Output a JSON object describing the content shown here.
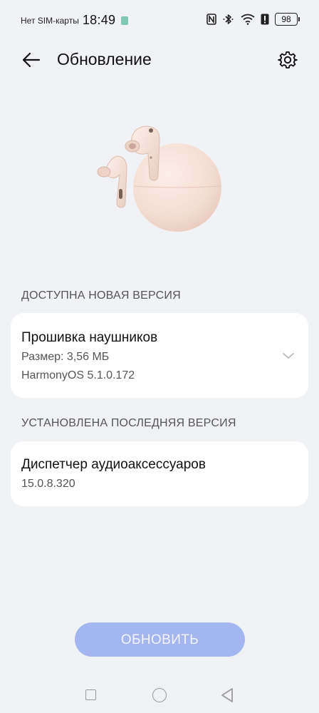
{
  "status_bar": {
    "carrier": "Нет SIM-карты",
    "time": "18:49",
    "battery": "98",
    "icons": [
      "sim-icon",
      "nfc-icon",
      "bluetooth-icon",
      "wifi-icon",
      "alert-icon",
      "battery-icon"
    ]
  },
  "header": {
    "title": "Обновление",
    "back_icon": "arrow-left-icon",
    "settings_icon": "gear-icon"
  },
  "product": {
    "image": "earbuds-with-case",
    "accent_color": "#f6e4dc"
  },
  "new_version": {
    "section_title": "ДОСТУПНА НОВАЯ ВЕРСИЯ",
    "title": "Прошивка наушников",
    "size": "Размер: 3,56 МБ",
    "version": "HarmonyOS 5.1.0.172",
    "expand_icon": "chevron-down-icon"
  },
  "installed": {
    "section_title": "УСТАНОВЛЕНА ПОСЛЕДНЯЯ ВЕРСИЯ",
    "title": "Диспетчер аудиоаксессуаров",
    "version": "15.0.8.320"
  },
  "update_button": {
    "label": "ОБНОВИТЬ",
    "color": "#a4b6f0"
  },
  "nav": {
    "icons": [
      "recent-apps-icon",
      "home-icon",
      "back-triangle-icon"
    ]
  }
}
